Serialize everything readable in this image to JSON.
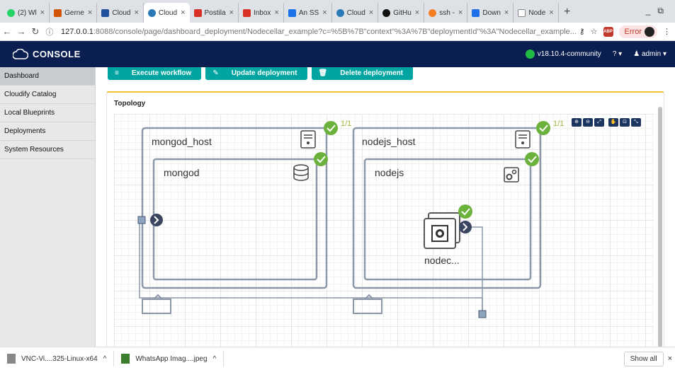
{
  "browser": {
    "tabs": [
      {
        "label": "(2) Wl",
        "icon": "whatsapp-icon",
        "color": "#25d366",
        "active": false
      },
      {
        "label": "Gerne",
        "icon": "pdf-icon",
        "color": "#d35400",
        "active": false
      },
      {
        "label": "Cloud",
        "icon": "rs-icon",
        "color": "#1f4e9c",
        "active": false
      },
      {
        "label": "Cloud",
        "icon": "cloudify-icon",
        "color": "#2a7ab8",
        "active": true
      },
      {
        "label": "Postila",
        "icon": "gmail-icon",
        "color": "#d93025",
        "active": false
      },
      {
        "label": "Inbox",
        "icon": "gmail-icon",
        "color": "#d93025",
        "active": false
      },
      {
        "label": "An SS",
        "icon": "doc-icon",
        "color": "#1a73e8",
        "active": false
      },
      {
        "label": "Cloud",
        "icon": "cloudify-icon",
        "color": "#2a7ab8",
        "active": false
      },
      {
        "label": "GitHu",
        "icon": "github-icon",
        "color": "#111111",
        "active": false
      },
      {
        "label": "ssh -",
        "icon": "so-icon",
        "color": "#f48024",
        "active": false
      },
      {
        "label": "Down",
        "icon": "vs-icon",
        "color": "#1f6feb",
        "active": false
      },
      {
        "label": "Node",
        "icon": "page-icon",
        "color": "#888888",
        "active": false
      }
    ],
    "new_tab": "+",
    "url_host": "127.0.0.1",
    "url_rest": ":8088/console/page/dashboard_deployment/Nodecellar_example?c=%5B%7B\"context\"%3A%7B\"deploymentId\"%3A\"Nodecellar_example...",
    "error_label": "Error"
  },
  "app": {
    "logo": "CONSOLE",
    "version": "v18.10.4-community",
    "help": "?",
    "user": "admin"
  },
  "sidebar": {
    "items": [
      {
        "label": "Dashboard",
        "active": true
      },
      {
        "label": "Cloudify Catalog",
        "active": false
      },
      {
        "label": "Local Blueprints",
        "active": false
      },
      {
        "label": "Deployments",
        "active": false
      },
      {
        "label": "System Resources",
        "active": false
      }
    ]
  },
  "actions": {
    "execute": "Execute workflow",
    "update": "Update deployment",
    "delete": "Delete deployment"
  },
  "topology": {
    "title": "Topology",
    "nodes": {
      "mongod_host": "mongod_host",
      "mongod_host_count": "1/1",
      "mongod": "mongod",
      "nodejs_host": "nodejs_host",
      "nodejs_host_count": "1/1",
      "nodejs": "nodejs",
      "nodecellar": "nodec..."
    },
    "colors": {
      "ok": "#6ab23b",
      "border": "#8c97a8",
      "connector": "#8ea3bd"
    }
  },
  "downloads": {
    "items": [
      {
        "label": "VNC-Vi....325-Linux-x64"
      },
      {
        "label": "WhatsApp Imag....jpeg"
      }
    ],
    "show_all": "Show all"
  }
}
